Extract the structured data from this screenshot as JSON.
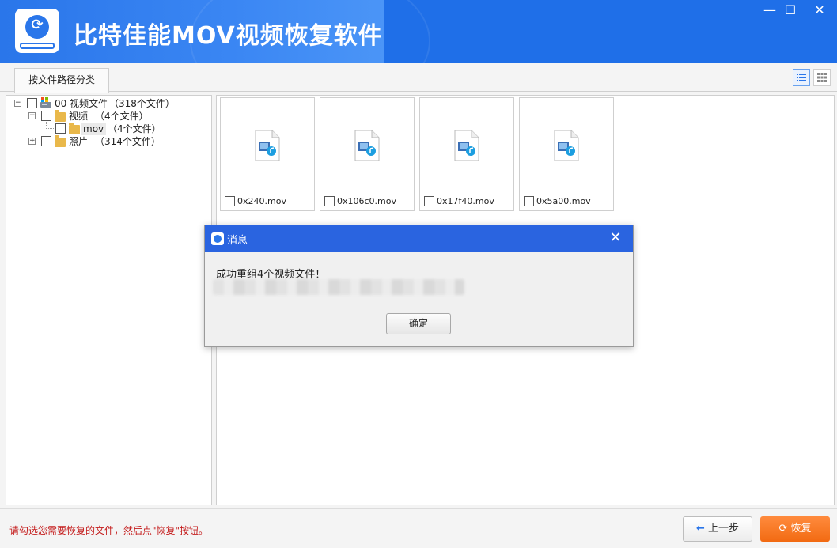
{
  "app": {
    "title": "比特佳能MOV视频恢复软件",
    "window_controls": {
      "minimize": "—",
      "maximize": "☐",
      "close": "✕"
    }
  },
  "tabs": [
    {
      "label": "按文件路径分类",
      "active": true
    }
  ],
  "view_modes": [
    {
      "name": "list-view",
      "active": true
    },
    {
      "name": "thumbnail-view",
      "active": false
    }
  ],
  "tree": {
    "root": {
      "label": "00 视频文件",
      "count": "（318个文件）",
      "expanded": true
    },
    "children": [
      {
        "label": "视频",
        "count": "（4个文件）",
        "expanded": true,
        "children": [
          {
            "label": "mov",
            "count": "（4个文件）",
            "selected": true
          }
        ]
      },
      {
        "label": "照片",
        "count": "（314个文件）",
        "expanded": false
      }
    ]
  },
  "files": [
    {
      "name": "0x240.mov",
      "checked": false
    },
    {
      "name": "0x106c0.mov",
      "checked": false
    },
    {
      "name": "0x17f40.mov",
      "checked": false
    },
    {
      "name": "0x5a00.mov",
      "checked": false
    }
  ],
  "status": {
    "hint": "请勾选您需要恢复的文件，然后点\"恢复\"按钮。",
    "prev_label": "上一步",
    "recover_label": "恢复"
  },
  "dialog": {
    "title": "消息",
    "message": "成功重组4个视频文件！",
    "ok_label": "确定"
  },
  "colors": {
    "titlebar": "#1f6fe8",
    "dialog_header": "#2a64e0",
    "accent_orange": "#f26a12",
    "hint_red": "#c41c1c"
  }
}
